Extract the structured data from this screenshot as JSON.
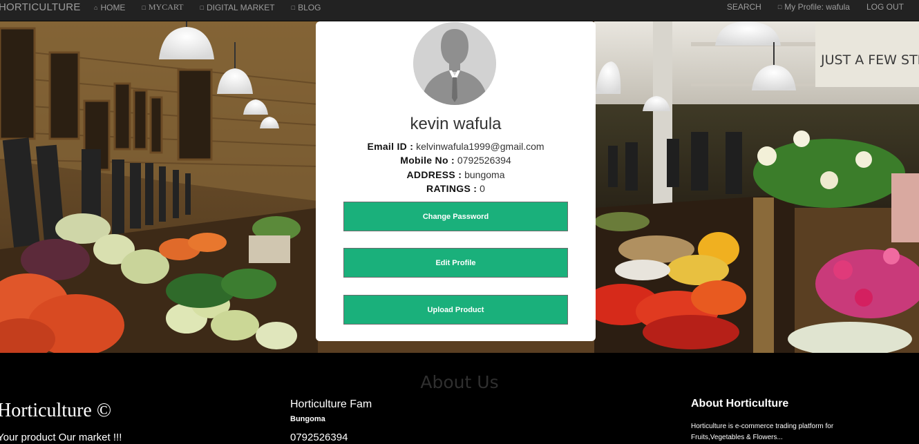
{
  "nav": {
    "brand": "HORTICULTURE",
    "left": [
      {
        "icon": "home-icon",
        "glyph": "⌂",
        "label": "HOME"
      },
      {
        "icon": "cart-icon",
        "glyph": "□",
        "label": "MYCART"
      },
      {
        "icon": "market-icon",
        "glyph": "□",
        "label": "DIGITAL MARKET"
      },
      {
        "icon": "blog-icon",
        "glyph": "□",
        "label": "BLOG"
      }
    ],
    "search": "SEARCH",
    "profile": "My Profile: wafula",
    "logout": "LOG OUT"
  },
  "profile": {
    "name": "kevin wafula",
    "email_label": "Email ID :",
    "email": "kelvinwafula1999@gmail.com",
    "mobile_label": "Mobile No :",
    "mobile": "0792526394",
    "address_label": "ADDRESS :",
    "address": "bungoma",
    "ratings_label": "RATINGS :",
    "ratings": "0"
  },
  "buttons": {
    "change_password": "Change Password",
    "edit_profile": "Edit Profile",
    "upload_product": "Upload Product"
  },
  "hero_sign": "JUST A FEW STE",
  "footer": {
    "about_title": "About Us",
    "brand": "Horticulture ©",
    "tagline": "Your product Our market !!!",
    "fam_title": "Horticulture Fam",
    "fam_location": "Bungoma",
    "fam_phone": "0792526394",
    "about_heading": "About Horticulture",
    "about_text": "Horticulture is e-commerce trading platform for Fruits,Vegetables & Flowers..."
  },
  "colors": {
    "navbar": "#222222",
    "nav_text": "#9d9d9d",
    "button": "#1ab07b",
    "footer": "#000000"
  }
}
